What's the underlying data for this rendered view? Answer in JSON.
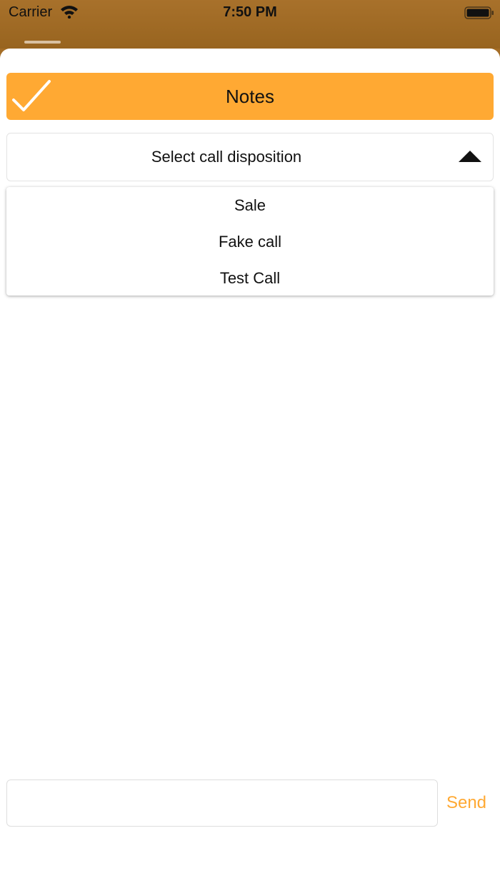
{
  "status_bar": {
    "carrier": "Carrier",
    "time": "7:50 PM",
    "wifi_icon": "wifi-icon",
    "battery_icon": "battery-icon"
  },
  "header": {
    "title": "Notes",
    "icon": "checkmark-icon"
  },
  "disposition": {
    "label": "Select call disposition",
    "icon": "caret-up-icon",
    "options": [
      "Sale",
      "Fake call",
      "Test Call"
    ]
  },
  "composer": {
    "value": "",
    "placeholder": "",
    "send_label": "Send"
  },
  "colors": {
    "accent": "#ffa933",
    "status_bar": "#a46d26",
    "background": "#ffffff"
  }
}
